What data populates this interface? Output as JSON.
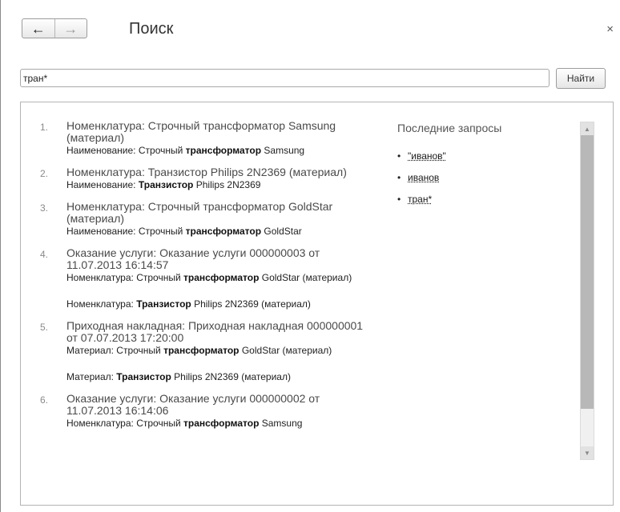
{
  "header": {
    "back_glyph": "←",
    "forward_glyph": "→",
    "title": "Поиск",
    "close_glyph": "×"
  },
  "search": {
    "value": "тран*",
    "button_label": "Найти"
  },
  "results": [
    {
      "number": "1.",
      "title": "Номенклатура: Строчный трансформатор Samsung (материал)",
      "details": [
        {
          "prefix": "Наименование: Строчный ",
          "bold": "трансформатор",
          "suffix": " Samsung"
        }
      ]
    },
    {
      "number": "2.",
      "title": "Номенклатура: Транзистор Philips 2N2369 (материал)",
      "details": [
        {
          "prefix": "Наименование: ",
          "bold": "Транзистор",
          "suffix": " Philips 2N2369"
        }
      ]
    },
    {
      "number": "3.",
      "title": "Номенклатура: Строчный трансформатор GoldStar (материал)",
      "details": [
        {
          "prefix": "Наименование: Строчный ",
          "bold": "трансформатор",
          "suffix": " GoldStar"
        }
      ]
    },
    {
      "number": "4.",
      "title": "Оказание услуги: Оказание услуги 000000003 от 11.07.2013 16:14:57",
      "details": [
        {
          "prefix": "Номенклатура: Строчный ",
          "bold": "трансформатор",
          "suffix": " GoldStar (материал)"
        },
        {
          "prefix": "Номенклатура: ",
          "bold": "Транзистор",
          "suffix": " Philips 2N2369 (материал)"
        }
      ]
    },
    {
      "number": "5.",
      "title": "Приходная накладная: Приходная накладная 000000001 от 07.07.2013 17:20:00",
      "details": [
        {
          "prefix": "Материал: Строчный ",
          "bold": "трансформатор",
          "suffix": " GoldStar (материал)"
        },
        {
          "prefix": "Материал: ",
          "bold": "Транзистор",
          "suffix": " Philips 2N2369 (материал)"
        }
      ]
    },
    {
      "number": "6.",
      "title": "Оказание услуги: Оказание услуги 000000002 от 11.07.2013 16:14:06",
      "details": [
        {
          "prefix": "Номенклатура: Строчный ",
          "bold": "трансформатор",
          "suffix": " Samsung"
        }
      ]
    }
  ],
  "recent": {
    "title": "Последние запросы",
    "bullet": "•",
    "items": [
      "\"иванов\"",
      "иванов",
      "тран*"
    ]
  },
  "scrollbar": {
    "up_glyph": "▲",
    "down_glyph": "▼"
  }
}
